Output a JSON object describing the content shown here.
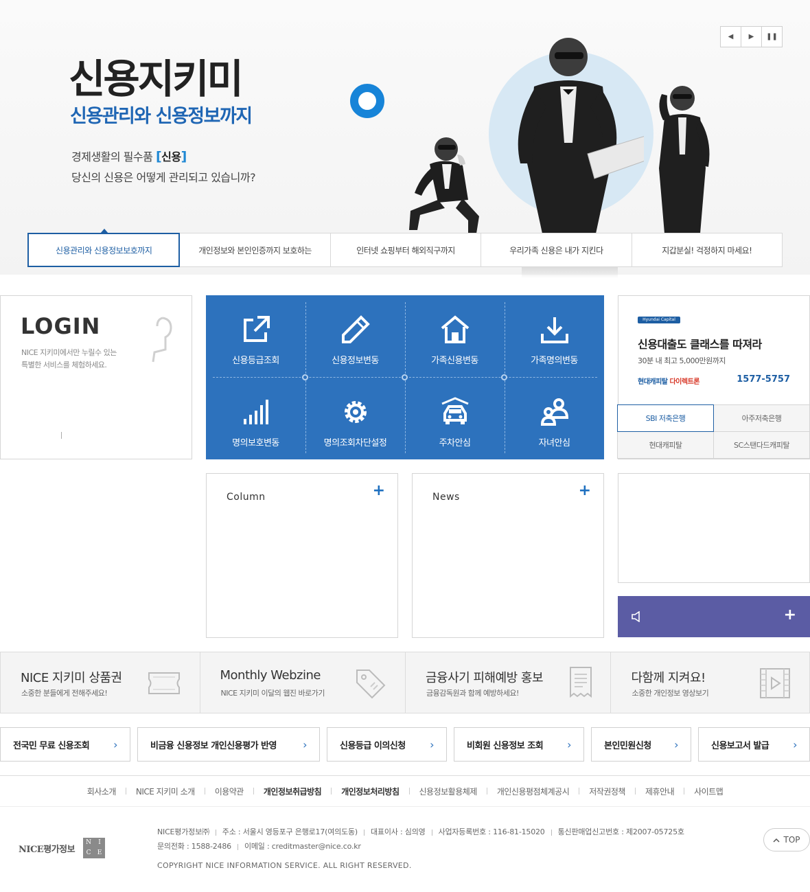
{
  "hero": {
    "title": "신용지키미",
    "subtitle": "신용관리와 신용정보까지",
    "line1_prefix": "경제생활의 필수품",
    "line1_bracket_open": "[",
    "line1_keyword": "신용",
    "line1_bracket_close": "]",
    "line2": "당신의 신용은 어떻게 관리되고 있습니까?",
    "controls": {
      "prev": "◀",
      "next": "▶",
      "pause": "❚❚"
    }
  },
  "tabs": [
    {
      "label": "신용관리와 신용정보보호까지",
      "active": true
    },
    {
      "label": "개인정보와 본인인증까지 보호하는"
    },
    {
      "label": "인터넷 쇼핑부터 해외직구까지"
    },
    {
      "label": "우리가족 신용은 내가 지킨다"
    },
    {
      "label": "지갑분실! 걱정하지 마세요!"
    }
  ],
  "login": {
    "title": "LOGIN",
    "desc_line1": "NICE 지키미에서만 누릴수 있는",
    "desc_line2": "특별한 서비스를 체험하세요."
  },
  "services": [
    {
      "label": "신용등급조회",
      "icon": "external-link-icon"
    },
    {
      "label": "신용정보변동",
      "icon": "pencil-icon"
    },
    {
      "label": "가족신용변동",
      "icon": "house-icon"
    },
    {
      "label": "가족명의변동",
      "icon": "download-icon"
    },
    {
      "label": "명의보호변동",
      "icon": "signal-bars-icon"
    },
    {
      "label": "명의조회차단설정",
      "icon": "gear-icon"
    },
    {
      "label": "주차안심",
      "icon": "car-icon"
    },
    {
      "label": "자녀안심",
      "icon": "family-icon"
    }
  ],
  "ad": {
    "logo": "Hyundai Capital",
    "title": "신용대출도 클래스를 따져라",
    "subtitle": "30분 내 최고 5,000만원까지",
    "brand_a": "현대캐피탈",
    "brand_b": "다이렉트론",
    "phone": "1577-5757",
    "tabs": [
      {
        "label": "SBI 저축은행",
        "active": true
      },
      {
        "label": "아주저축은행"
      },
      {
        "label": "현대캐피탈"
      },
      {
        "label": "SC스탠다드캐피탈"
      }
    ]
  },
  "boards": {
    "column": {
      "title": "Column",
      "plus": "+"
    },
    "news": {
      "title": "News",
      "plus": "+"
    }
  },
  "notice": {
    "plus": "+"
  },
  "promos": [
    {
      "title": "NICE 지키미 상품권",
      "sub": "소중한 분들에게 전해주세요!",
      "icon": "ticket-icon"
    },
    {
      "title": "Monthly Webzine",
      "sub": "NICE 지키미 이달의 웹진 바로가기",
      "icon": "tag-icon"
    },
    {
      "title": "금융사기 피해예방 홍보",
      "sub": "금융감독원과 함께 예방하세요!",
      "icon": "receipt-icon"
    },
    {
      "title": "다함께 지켜요!",
      "sub": "소중한 개인정보 영상보기",
      "icon": "video-icon"
    }
  ],
  "quick_links": [
    {
      "label": "전국민 무료 신용조회"
    },
    {
      "label": "비금융 신용정보 개인신용평가 반영"
    },
    {
      "label": "신용등급 이의신청"
    },
    {
      "label": "비회원 신용정보 조회"
    },
    {
      "label": "본인민원신청"
    },
    {
      "label": "신용보고서 발급"
    }
  ],
  "quick_arrow": "›",
  "footer_nav": [
    {
      "label": "회사소개"
    },
    {
      "label": "NICE 지키미 소개"
    },
    {
      "label": "이용약관"
    },
    {
      "label": "개인정보취급방침",
      "bold": true
    },
    {
      "label": "개인정보처리방침",
      "bold": true
    },
    {
      "label": "신용정보활용체제"
    },
    {
      "label": "개인신용평점체계공시"
    },
    {
      "label": "저작권정책"
    },
    {
      "label": "제휴안내"
    },
    {
      "label": "사이트맵"
    }
  ],
  "footer": {
    "logo_text": "NICE평가정보",
    "logo_box": [
      "N",
      "I",
      "C",
      "E"
    ],
    "company": "NICE평가정보㈜",
    "address": "주소 : 서울시 영등포구 은행로17(여의도동)",
    "ceo": "대표이사 : 심의영",
    "biz_no": "사업자등록번호 : 116-81-15020",
    "sales_no": "통신판매업신고번호 : 제2007-05725호",
    "phone": "문의전화 : 1588-2486",
    "email": "이메일 : creditmaster@nice.co.kr",
    "copyright": "COPYRIGHT NICE INFORMATION SERVICE. ALL RIGHT RESERVED.",
    "top": "TOP"
  }
}
